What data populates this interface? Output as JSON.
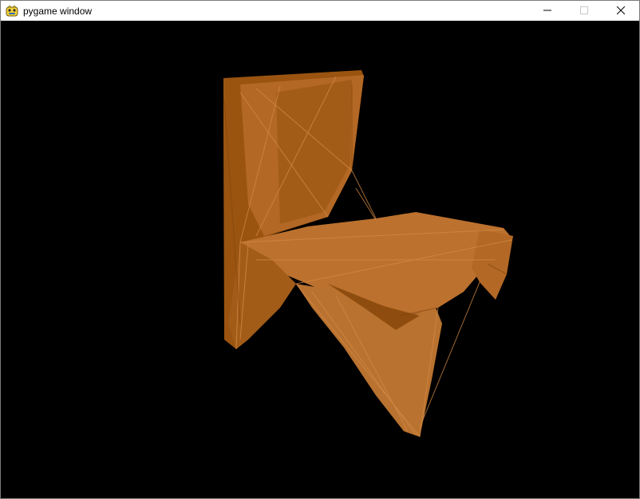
{
  "window": {
    "title": "pygame window",
    "icon": "pygame-snake-icon",
    "controls": [
      {
        "name": "minimize",
        "icon": "minimize-icon"
      },
      {
        "name": "maximize",
        "icon": "maximize-icon"
      },
      {
        "name": "close",
        "icon": "close-icon"
      }
    ]
  },
  "scene": {
    "background": "#000000",
    "object": "chair",
    "render_style": "wireframe",
    "colors": {
      "light": "#C87A3A",
      "mid": "#B36825",
      "dark": "#9A5410"
    }
  }
}
